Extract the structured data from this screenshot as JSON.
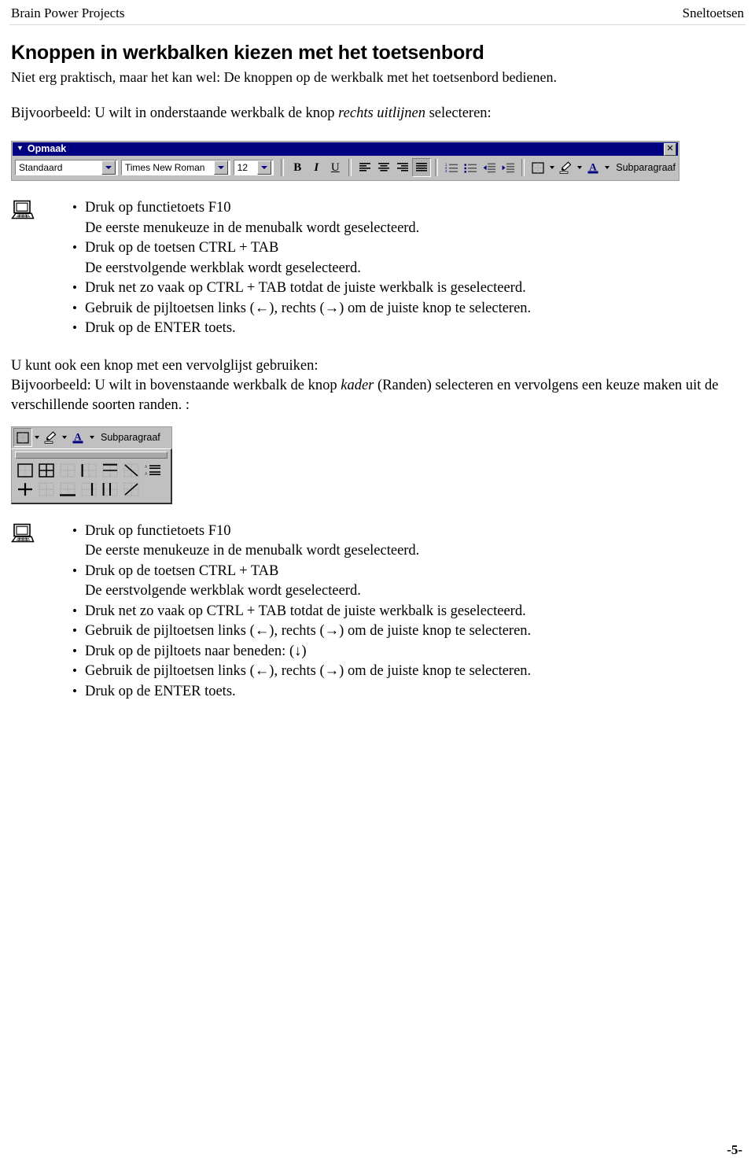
{
  "header": {
    "left": "Brain Power Projects",
    "right": "Sneltoetsen"
  },
  "footer": {
    "page_number": "-5-"
  },
  "title": "Knoppen in werkbalken kiezen met het toetsenbord",
  "lead": "Niet erg praktisch, maar het kan wel: De knoppen op de werkbalk met het toetsenbord bedienen.",
  "example_intro": {
    "before": "Bijvoorbeeld: U wilt in onderstaande werkbalk de knop ",
    "emphasis": "rechts uitlijnen",
    "after": " selecteren:"
  },
  "toolbar": {
    "title": "Opmaak",
    "close_label": "✕",
    "style_combo": "Standaard",
    "font_combo": "Times New Roman",
    "size_combo": "12",
    "bold_label": "B",
    "italic_label": "I",
    "underline_label": "U",
    "buttons": [
      "align-left",
      "align-center",
      "align-right",
      "justify",
      "numbered-list",
      "bulleted-list",
      "decrease-indent",
      "increase-indent",
      "borders",
      "highlight",
      "font-color"
    ],
    "subparagraph_label": "Subparagraaf",
    "title_bar_color": "#000080",
    "face_color": "#c0c0c0"
  },
  "steps_first": [
    {
      "main": "Druk op functietoets F10",
      "sub": "De eerste menukeuze in de menubalk wordt geselecteerd."
    },
    {
      "main": "Druk op de toetsen CTRL + TAB",
      "sub": "De eerstvolgende werkblak wordt geselecteerd."
    },
    {
      "main": "Druk net zo vaak op CTRL + TAB totdat de juiste werkbalk is geselecteerd.",
      "sub": ""
    },
    {
      "main": "Gebruik de pijltoetsen links (←), rechts (→) om de juiste knop te selecteren.",
      "sub": ""
    },
    {
      "main": "Druk op de ENTER toets.",
      "sub": ""
    }
  ],
  "middle": {
    "line1": "U kunt ook een knop met een vervolglijst gebruiken:",
    "line2_before": "Bijvoorbeeld: U wilt in bovenstaande werkbalk de knop ",
    "line2_emphasis": "kader",
    "line2_after": " (Randen) selecteren en vervolgens een keuze maken uit de verschillende soorten randen. :"
  },
  "borders_panel": {
    "subparagraph_label": "Subparagraaf",
    "cells_row1": [
      "border-outside",
      "border-all",
      "border-none",
      "border-left",
      "border-top-bottom",
      "border-diagonal-down",
      "border-text"
    ],
    "cells_row2": [
      "border-inside-cross",
      "border-inside-grid",
      "border-bottom-thick",
      "border-inside-vertical",
      "border-left-right",
      "border-diagonal-up"
    ]
  },
  "steps_second": [
    {
      "main": "Druk op functietoets F10",
      "sub": "De eerste menukeuze in de menubalk wordt geselecteerd."
    },
    {
      "main": "Druk op de toetsen CTRL + TAB",
      "sub": "De eerstvolgende werkblak wordt geselecteerd."
    },
    {
      "main": "Druk net zo vaak op CTRL + TAB totdat de juiste werkbalk is geselecteerd.",
      "sub": ""
    },
    {
      "main": "Gebruik de pijltoetsen links (←), rechts (→) om de juiste knop te selecteren.",
      "sub": ""
    },
    {
      "main": "Druk op de pijltoets naar beneden: (↓)",
      "sub": ""
    },
    {
      "main": "Gebruik de pijltoetsen links (←), rechts (→) om de juiste knop te selecteren.",
      "sub": ""
    },
    {
      "main": "Druk op de ENTER toets.",
      "sub": ""
    }
  ]
}
